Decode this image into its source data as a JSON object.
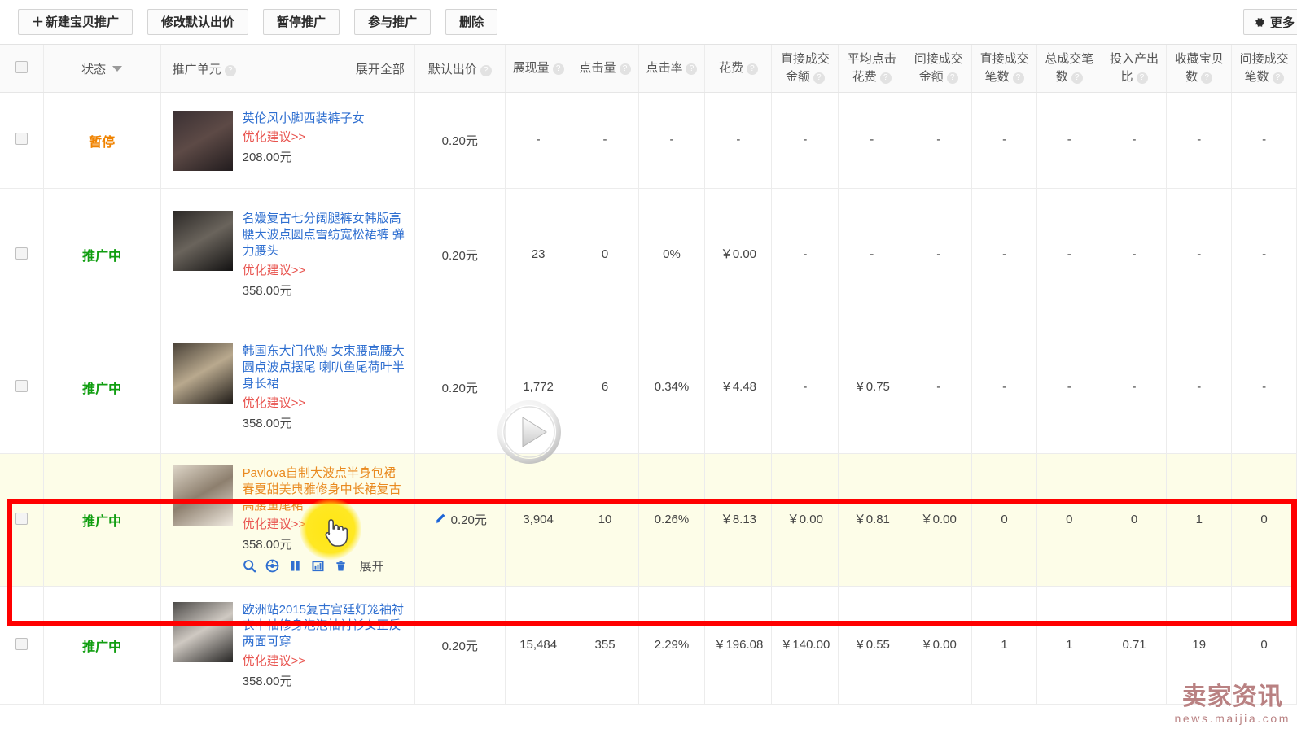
{
  "toolbar": {
    "buttons": [
      {
        "id": "new-promo",
        "label": "新建宝贝推广",
        "plus": "＋"
      },
      {
        "id": "modify-bid",
        "label": "修改默认出价"
      },
      {
        "id": "pause-promo",
        "label": "暂停推广"
      },
      {
        "id": "join-promo",
        "label": "参与推广"
      },
      {
        "id": "delete",
        "label": "删除"
      }
    ],
    "more_button": {
      "label": "更多",
      "icon": "gear-icon"
    }
  },
  "table": {
    "header": {
      "select_all_icon": "checkbox-icon",
      "state": {
        "label": "状态",
        "sort_icon": "caret-down-icon"
      },
      "unit": {
        "label": "推广单元",
        "help": "?",
        "expand_all": "展开全部"
      },
      "bid": {
        "label": "默认出价",
        "help": "?"
      },
      "metrics": [
        {
          "id": "impressions",
          "lines": [
            "展现量"
          ],
          "help": "?"
        },
        {
          "id": "clicks",
          "lines": [
            "点击量"
          ],
          "help": "?"
        },
        {
          "id": "ctr",
          "lines": [
            "点击率"
          ],
          "help": "?"
        },
        {
          "id": "cost",
          "lines": [
            "花费"
          ],
          "help": "?"
        },
        {
          "id": "direct-amount",
          "lines": [
            "直接成交",
            "金额"
          ],
          "help": "?"
        },
        {
          "id": "avg-click-cost",
          "lines": [
            "平均点击",
            "花费"
          ],
          "help": "?"
        },
        {
          "id": "indirect-amount",
          "lines": [
            "间接成交",
            "金额"
          ],
          "help": "?"
        },
        {
          "id": "direct-orders",
          "lines": [
            "直接成交",
            "笔数"
          ],
          "help": "?"
        },
        {
          "id": "total-orders",
          "lines": [
            "总成交笔",
            "数"
          ],
          "help": "?"
        },
        {
          "id": "roi",
          "lines": [
            "投入产出",
            "比"
          ],
          "help": "?"
        },
        {
          "id": "favorites",
          "lines": [
            "收藏宝贝",
            "数"
          ],
          "help": "?"
        },
        {
          "id": "indirect-orders",
          "lines": [
            "间接成交",
            "笔数"
          ],
          "help": "?"
        }
      ]
    },
    "rows": [
      {
        "state": "暂停",
        "state_kind": "paused",
        "title": "英伦风小脚西装裤子女",
        "optimize": "优化建议>>",
        "price": "208.00元",
        "bid": "0.20元",
        "metrics": [
          "-",
          "-",
          "-",
          "-",
          "-",
          "-",
          "-",
          "-",
          "-",
          "-",
          "-",
          "-"
        ],
        "highlighted": false,
        "has_actions": false
      },
      {
        "state": "推广中",
        "state_kind": "active",
        "title": "名媛复古七分阔腿裤女韩版高腰大波点圆点雪纺宽松裙裤 弹力腰头",
        "optimize": "优化建议>>",
        "price": "358.00元",
        "bid": "0.20元",
        "metrics": [
          "23",
          "0",
          "0%",
          "￥0.00",
          "-",
          "-",
          "-",
          "-",
          "-",
          "-",
          "-",
          "-"
        ],
        "highlighted": false,
        "has_actions": false
      },
      {
        "state": "推广中",
        "state_kind": "active",
        "title": "韩国东大门代购 女束腰高腰大圆点波点摆尾 喇叭鱼尾荷叶半身长裙",
        "optimize": "优化建议>>",
        "price": "358.00元",
        "bid": "0.20元",
        "metrics": [
          "1,772",
          "6",
          "0.34%",
          "￥4.48",
          "-",
          "￥0.75",
          "-",
          "-",
          "-",
          "-",
          "-",
          "-"
        ],
        "highlighted": false,
        "has_actions": false
      },
      {
        "state": "推广中",
        "state_kind": "active",
        "title": "Pavlova自制大波点半身包裙春夏甜美典雅修身中长裙复古高腰鱼尾裙",
        "optimize": "优化建议>>",
        "price": "358.00元",
        "bid": "0.20元",
        "metrics": [
          "3,904",
          "10",
          "0.26%",
          "￥8.13",
          "￥0.00",
          "￥0.81",
          "￥0.00",
          "0",
          "0",
          "0",
          "1",
          "0"
        ],
        "highlighted": true,
        "has_actions": true,
        "edit_icon": "pencil-icon",
        "actions": [
          {
            "id": "search",
            "icon": "search-icon"
          },
          {
            "id": "target",
            "icon": "target-icon"
          },
          {
            "id": "pause",
            "icon": "pause-icon"
          },
          {
            "id": "report",
            "icon": "report-icon"
          },
          {
            "id": "delete",
            "icon": "trash-icon"
          },
          {
            "id": "expand",
            "icon": "expand-text",
            "label": "展开"
          }
        ]
      },
      {
        "state": "推广中",
        "state_kind": "active",
        "title": "欧洲站2015复古宫廷灯笼袖衬衣中袖修身泡泡袖衬衫女正反两面可穿",
        "optimize": "优化建议>>",
        "price": "358.00元",
        "bid": "0.20元",
        "metrics": [
          "15,484",
          "355",
          "2.29%",
          "￥196.08",
          "￥140.00",
          "￥0.55",
          "￥0.00",
          "1",
          "1",
          "0.71",
          "19",
          "0"
        ],
        "highlighted": false,
        "has_actions": false
      }
    ]
  },
  "overlays": {
    "play_button": "play-icon",
    "highlight_border_color": "#ff0000",
    "cursor": "hand-cursor-icon"
  },
  "watermark": {
    "brand": "卖家资讯",
    "url": "news.maijia.com"
  },
  "colors": {
    "paused": "#f08300",
    "active": "#119e11",
    "link": "#2f6fd0",
    "optimize": "#e8534e",
    "highlight_title": "#e98a20",
    "row_highlight_bg": "#fdfde8",
    "border_red": "#ff0000"
  }
}
